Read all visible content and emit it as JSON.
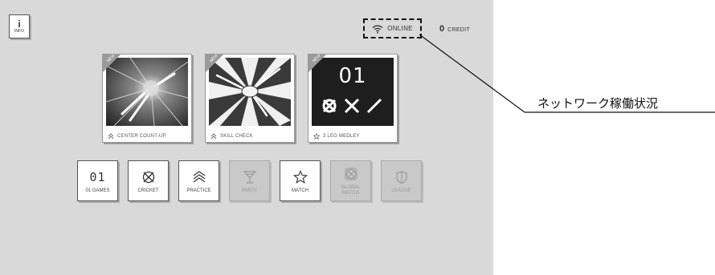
{
  "info_button": {
    "label": "INFO"
  },
  "status": {
    "online_label": "ONLINE",
    "credit_count": "0",
    "credit_label": "CREDIT"
  },
  "cards": [
    {
      "name": "CENTER COUNT-UP",
      "badge": "NEW"
    },
    {
      "name": "SKILL CHECK",
      "badge": "NEW"
    },
    {
      "name": "3 LEG MEDLEY",
      "badge": "NEW",
      "art_number": "01"
    }
  ],
  "modes": [
    {
      "label": "01 GAMES",
      "glyph": "01",
      "enabled": true
    },
    {
      "label": "CRICKET",
      "enabled": true
    },
    {
      "label": "PRACTICE",
      "enabled": true
    },
    {
      "label": "PARTY",
      "enabled": false
    },
    {
      "label": "MATCH",
      "enabled": true
    },
    {
      "label": "GLOBAL MATCH",
      "line1": "GLOBAL",
      "line2": "MATCH",
      "enabled": false
    },
    {
      "label": "LEAGUE",
      "enabled": false
    }
  ],
  "callout": {
    "label": "ネットワーク稼働状況"
  }
}
